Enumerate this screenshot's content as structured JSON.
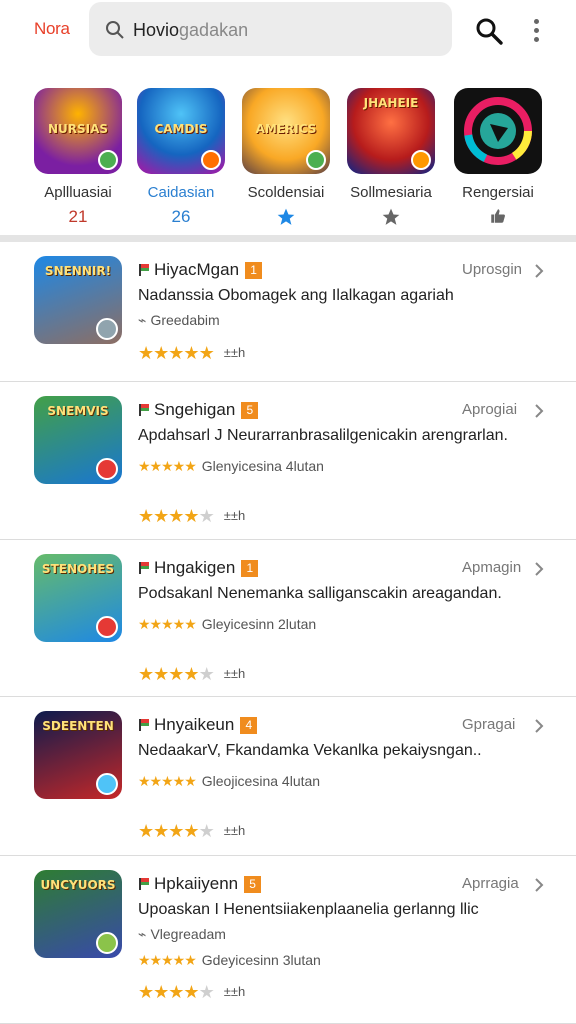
{
  "header": {
    "brand": "Nora",
    "search_value_a": "Hovio",
    "search_value_b": "gadakan",
    "search_icon": "search-icon",
    "search_button_icon": "search-icon",
    "more_icon": "more-vert-icon"
  },
  "featured": [
    {
      "tile_text": "NURSIAS",
      "label": "Apllluasiai",
      "value": "21",
      "color_a": "#7b1fa2",
      "color_b": "#ff9800",
      "badge": "#4caf50"
    },
    {
      "tile_text": "CAMDIS",
      "label": "Caidasian",
      "value": "26",
      "color_a": "#1565c0",
      "color_b": "#ab47bc",
      "badge": "#ff6f00"
    },
    {
      "tile_text": "AMERICS",
      "label": "Scoldensiai",
      "value": "star-icon",
      "color_a": "#f9a825",
      "color_b": "#5d4037",
      "badge": "#4caf50"
    },
    {
      "tile_text": "JHAHEIE",
      "label": "Sollmesiaria",
      "value": "star-icon",
      "color_a": "#1a237e",
      "color_b": "#d84315",
      "badge": "#ff9800"
    },
    {
      "tile_text": "",
      "label": "Rengersiai",
      "value": "thumb-icon",
      "color_a": "#111111",
      "color_b": "#e91e63",
      "badge": ""
    }
  ],
  "list": [
    {
      "icon_text": "SNENNIR!",
      "title": "HiyacMgan",
      "num": "1",
      "side": "Uprosgin",
      "desc": "Nadanssia Obomagek ang Ilalkagan agariah",
      "sub_icon": "tag-icon",
      "sub": "Greedabim",
      "stars_on": 5,
      "stars_off": 0,
      "count": "±±h",
      "color_a": "#1e88e5",
      "color_b": "#8d6e63",
      "badge": "#90a4ae",
      "mini_stars": false
    },
    {
      "icon_text": "SNEMVIS",
      "title": "Sngehigan",
      "num": "5",
      "side": "Aprogiai",
      "desc": "Apdahsarl J Neurarranbrasalilgenicakin arengrarlan.",
      "sub": "Glenyicesina 4lutan",
      "stars_on": 4,
      "stars_off": 1,
      "count": "±±h",
      "color_a": "#43a047",
      "color_b": "#1976d2",
      "badge": "#e53935",
      "mini_stars": true
    },
    {
      "icon_text": "STENOHES",
      "title": "Hngakigen",
      "num": "1",
      "side": "Apmagin",
      "desc": "Podsakanl Nenemanka salliganscakin areagandan.",
      "sub": "Gleyicesinn 2lutan",
      "stars_on": 4,
      "stars_off": 1,
      "count": "±±h",
      "color_a": "#66bb6a",
      "color_b": "#1e88e5",
      "badge": "#e53935",
      "mini_stars": true
    },
    {
      "icon_text": "SDEENTEN",
      "title": "Hnyaikeun",
      "num": "4",
      "side": "Gpragai",
      "desc": "NedaakarV, Fkandamka Vekanlka pekaiysngan..",
      "sub": "Gleojicesina 4lutan",
      "stars_on": 4,
      "stars_off": 1,
      "count": "±±h",
      "color_a": "#0d1b4d",
      "color_b": "#c62828",
      "badge": "#4fc3f7",
      "mini_stars": true
    },
    {
      "icon_text": "UNCYUORS",
      "title": "Hpkaiiyenn",
      "num": "5",
      "side": "Aprragia",
      "desc": "Upoaskan I Henentsiiakenplaanelia gerlanng llic",
      "sub_icon": "tag-icon",
      "sub": "Vlegreadam",
      "sub2": "Gdeyicesinn 3lutan",
      "stars_on": 4,
      "stars_off": 1,
      "count": "±±h",
      "color_a": "#2e7d32",
      "color_b": "#3949ab",
      "badge": "#8bc34a",
      "mini_stars": true
    }
  ]
}
